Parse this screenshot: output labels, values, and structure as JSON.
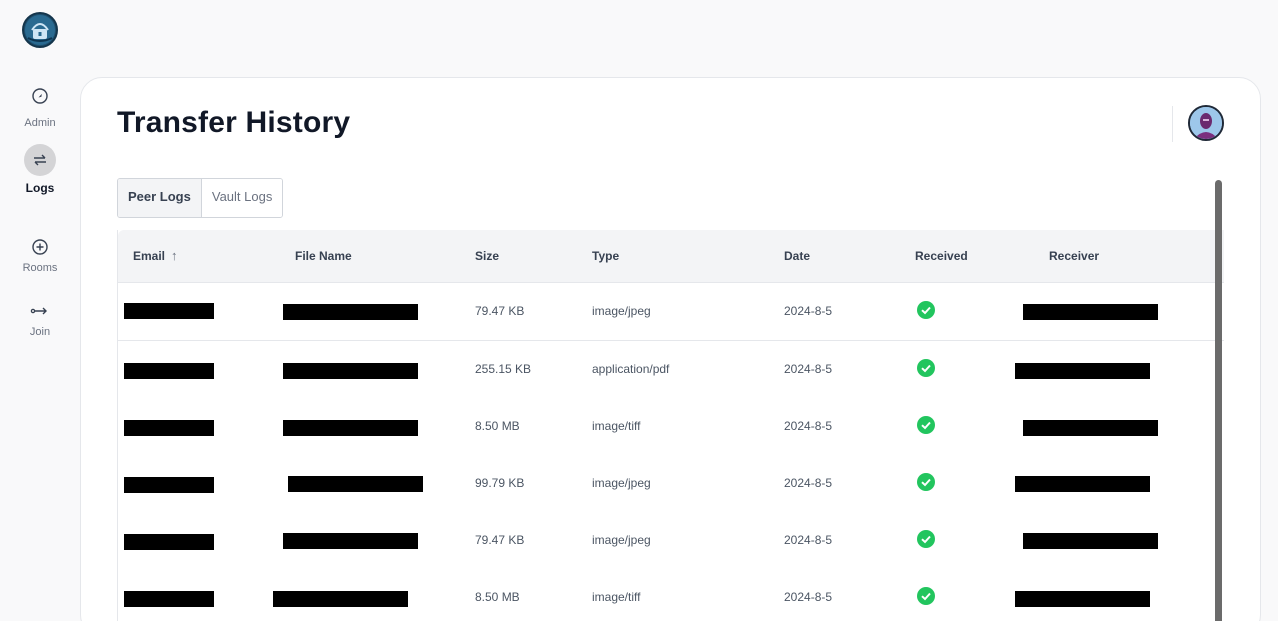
{
  "sidebar": {
    "items": [
      {
        "label": "Admin",
        "icon": "compass-icon",
        "active": false
      },
      {
        "label": "Logs",
        "icon": "transfer-arrows-icon",
        "active": true
      },
      {
        "label": "Rooms",
        "icon": "plus-circle-icon",
        "active": false
      },
      {
        "label": "Join",
        "icon": "join-arrow-icon",
        "active": false
      }
    ]
  },
  "header": {
    "title": "Transfer History"
  },
  "tabs": [
    {
      "label": "Peer Logs",
      "active": true
    },
    {
      "label": "Vault Logs",
      "active": false
    }
  ],
  "table": {
    "columns": {
      "email": "Email",
      "file_name": "File Name",
      "size": "Size",
      "type": "Type",
      "date": "Date",
      "received": "Received",
      "receiver": "Receiver"
    },
    "sort": {
      "column": "email",
      "direction": "ascending",
      "icon": "arrow-up-icon"
    },
    "rows": [
      {
        "size": "79.47 KB",
        "type": "image/jpeg",
        "date": "2024-8-5",
        "received": true
      },
      {
        "size": "255.15 KB",
        "type": "application/pdf",
        "date": "2024-8-5",
        "received": true
      },
      {
        "size": "8.50 MB",
        "type": "image/tiff",
        "date": "2024-8-5",
        "received": true
      },
      {
        "size": "99.79 KB",
        "type": "image/jpeg",
        "date": "2024-8-5",
        "received": true
      },
      {
        "size": "79.47 KB",
        "type": "image/jpeg",
        "date": "2024-8-5",
        "received": true
      },
      {
        "size": "8.50 MB",
        "type": "image/tiff",
        "date": "2024-8-5",
        "received": true
      }
    ]
  },
  "colors": {
    "accent_success": "#22c55e",
    "logo_blue": "#1e4f6f"
  }
}
